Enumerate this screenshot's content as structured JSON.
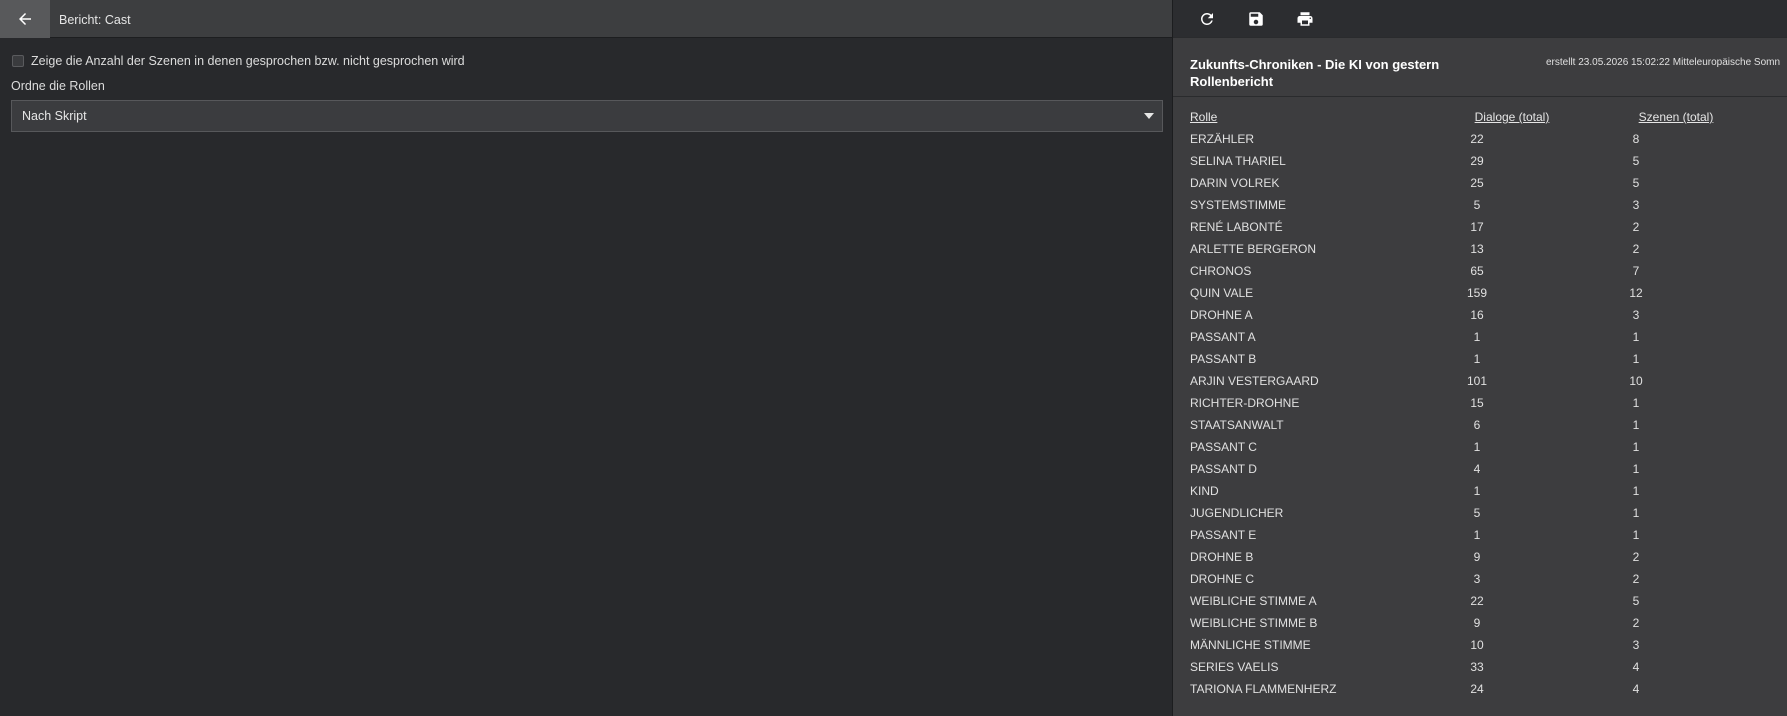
{
  "left": {
    "title": "Bericht: Cast",
    "show_scene_count_label": "Zeige die Anzahl der Szenen in denen gesprochen bzw. nicht gesprochen wird",
    "order_label": "Ordne die Rollen",
    "order_selected": "Nach Skript"
  },
  "report": {
    "title_line1": "Zukunfts-Chroniken - Die KI von gestern",
    "title_line2": "Rollenbericht",
    "created": "erstellt 23.05.2026 15:02:22 Mitteleuropäische Somn",
    "columns": {
      "role": "Rolle",
      "dialogs": "Dialoge (total)",
      "scenes": "Szenen (total)"
    },
    "rows": [
      {
        "role": "ERZÄHLER",
        "dialogs": "22",
        "scenes": "8"
      },
      {
        "role": "SELINA THARIEL",
        "dialogs": "29",
        "scenes": "5"
      },
      {
        "role": "DARIN VOLREK",
        "dialogs": "25",
        "scenes": "5"
      },
      {
        "role": "SYSTEMSTIMME",
        "dialogs": "5",
        "scenes": "3"
      },
      {
        "role": "RENÉ LABONTÉ",
        "dialogs": "17",
        "scenes": "2"
      },
      {
        "role": "ARLETTE BERGERON",
        "dialogs": "13",
        "scenes": "2"
      },
      {
        "role": "CHRONOS",
        "dialogs": "65",
        "scenes": "7"
      },
      {
        "role": "QUIN VALE",
        "dialogs": "159",
        "scenes": "12"
      },
      {
        "role": "DROHNE A",
        "dialogs": "16",
        "scenes": "3"
      },
      {
        "role": "PASSANT A",
        "dialogs": "1",
        "scenes": "1"
      },
      {
        "role": "PASSANT B",
        "dialogs": "1",
        "scenes": "1"
      },
      {
        "role": "ARJIN VESTERGAARD",
        "dialogs": "101",
        "scenes": "10"
      },
      {
        "role": "RICHTER-DROHNE",
        "dialogs": "15",
        "scenes": "1"
      },
      {
        "role": "STAATSANWALT",
        "dialogs": "6",
        "scenes": "1"
      },
      {
        "role": "PASSANT C",
        "dialogs": "1",
        "scenes": "1"
      },
      {
        "role": "PASSANT D",
        "dialogs": "4",
        "scenes": "1"
      },
      {
        "role": "KIND",
        "dialogs": "1",
        "scenes": "1"
      },
      {
        "role": "JUGENDLICHER",
        "dialogs": "5",
        "scenes": "1"
      },
      {
        "role": "PASSANT E",
        "dialogs": "1",
        "scenes": "1"
      },
      {
        "role": "DROHNE B",
        "dialogs": "9",
        "scenes": "2"
      },
      {
        "role": "DROHNE C",
        "dialogs": "3",
        "scenes": "2"
      },
      {
        "role": "WEIBLICHE STIMME A",
        "dialogs": "22",
        "scenes": "5"
      },
      {
        "role": "WEIBLICHE STIMME B",
        "dialogs": "9",
        "scenes": "2"
      },
      {
        "role": "MÄNNLICHE STIMME",
        "dialogs": "10",
        "scenes": "3"
      },
      {
        "role": "SERIES VAELIS",
        "dialogs": "33",
        "scenes": "4"
      },
      {
        "role": "TARIONA FLAMMENHERZ",
        "dialogs": "24",
        "scenes": "4"
      }
    ]
  },
  "icons": {
    "back": "arrow-left-icon",
    "refresh": "refresh-icon",
    "save": "save-icon",
    "print": "print-icon"
  }
}
